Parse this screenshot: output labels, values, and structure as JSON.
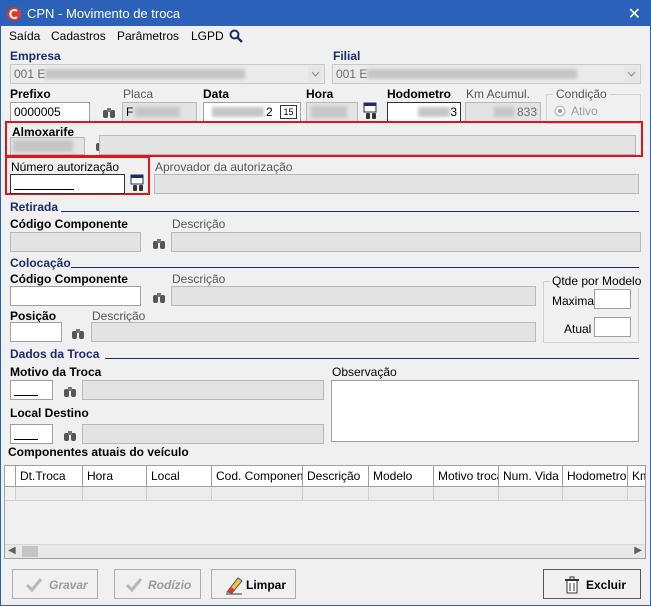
{
  "window": {
    "title": "CPN - Movimento de troca",
    "close_glyph": "✕"
  },
  "menu": {
    "items": [
      "Saída",
      "Cadastros",
      "Parâmetros",
      "LGPD"
    ]
  },
  "header": {
    "empresa_label": "Empresa",
    "empresa_value": "001 E",
    "filial_label": "Filial",
    "filial_value": "001 E",
    "prefixo_label": "Prefixo",
    "prefixo_value": "0000005",
    "placa_label": "Placa",
    "placa_value": "F",
    "data_label": "Data",
    "data_value": "2",
    "calendar_day": "15",
    "hora_label": "Hora",
    "hodometro_label": "Hodometro",
    "hodometro_value": "3",
    "km_label": "Km Acumul.",
    "km_value": "833",
    "condicao_label": "Condição",
    "ativo_label": "Ativo"
  },
  "almoxarife": {
    "label": "Almoxarife"
  },
  "autorizacao": {
    "numero_label": "Número autorização",
    "aprovador_label": "Aprovador da autorização"
  },
  "retirada": {
    "section": "Retirada",
    "codigo_label": "Código Componente",
    "descricao_label": "Descrição"
  },
  "colocacao": {
    "section": "Colocação",
    "codigo_label": "Código Componente",
    "descricao_label": "Descrição",
    "posicao_label": "Posição",
    "posicao_descricao_label": "Descrição",
    "qtde_label": "Qtde por Modelo",
    "maxima_label": "Maxima",
    "atual_label": "Atual"
  },
  "dados": {
    "section": "Dados da Troca",
    "motivo_label": "Motivo da Troca",
    "local_label": "Local Destino",
    "observacao_label": "Observação",
    "componentes_label": "Componentes atuais do veículo"
  },
  "grid": {
    "columns": [
      "Dt.Troca",
      "Hora",
      "Local",
      "Cod. Componente",
      "Descrição",
      "Modelo",
      "Motivo troca",
      "Num. Vida",
      "Hodometro V",
      "Km"
    ]
  },
  "buttons": {
    "gravar": "Gravar",
    "rodizio": "Rodízio",
    "limpar": "Limpar",
    "excluir": "Excluir"
  },
  "colors": {
    "title_bar": "#2b61b8",
    "section_navy": "#1a2c6b",
    "highlight": "#e1141c"
  }
}
